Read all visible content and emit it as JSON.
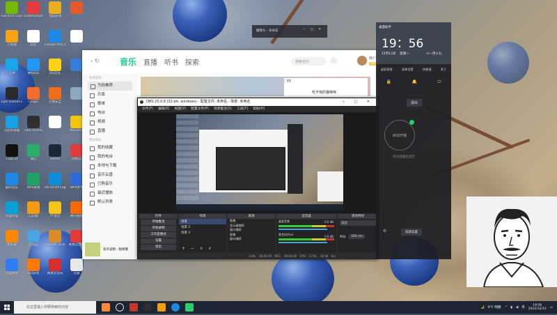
{
  "desktop": {
    "icons": [
      {
        "label": "GeForce Experience",
        "color": "#76b900"
      },
      {
        "label": "GameViewer",
        "color": "#e83c3c"
      },
      {
        "label": "猎狐游戏",
        "color": "#e8b020"
      },
      {
        "label": "",
        "color": "#e55a2a"
      },
      {
        "label": "小狐狸",
        "color": "#f7a21b"
      },
      {
        "label": "必剪",
        "color": "#fff"
      },
      {
        "label": "Google Play 商店",
        "color": "#1e88e5"
      },
      {
        "label": "",
        "color": "#ffffff"
      },
      {
        "label": "飞书",
        "color": "#1aa6e6"
      },
      {
        "label": "腾讯QQ",
        "color": "#2196f3"
      },
      {
        "label": "QQ音乐",
        "color": "#ffd21a"
      },
      {
        "label": "",
        "color": "#3a7dd6"
      },
      {
        "label": "Epic Games Launcher",
        "color": "#2a2a2a"
      },
      {
        "label": "Origin",
        "color": "#f56c2d"
      },
      {
        "label": "火绒安全",
        "color": "#ef6c1c"
      },
      {
        "label": "",
        "color": "#8ab"
      },
      {
        "label": "迅游加速器",
        "color": "#1aa0e6"
      },
      {
        "label": "OBS Studio",
        "color": "#302e31"
      },
      {
        "label": "",
        "color": "#fff"
      },
      {
        "label": "WeGame",
        "color": "#f1c40f"
      },
      {
        "label": "CapCut",
        "color": "#111"
      },
      {
        "label": "微信",
        "color": "#2aae67"
      },
      {
        "label": "Steam",
        "color": "#1b2838"
      },
      {
        "label": "网易云",
        "color": "#e03a3a"
      },
      {
        "label": "酷狗音乐",
        "color": "#1e88e5"
      },
      {
        "label": "WPS表格",
        "color": "#21a366"
      },
      {
        "label": "Microsoft Edge",
        "color": "#0f8ed8"
      },
      {
        "label": "WPS文字",
        "color": "#2f6ad6"
      },
      {
        "label": "哔哩哔哩",
        "color": "#00a1d6"
      },
      {
        "label": "向日葵",
        "color": "#f39c12"
      },
      {
        "label": "YY语音",
        "color": "#f5c518"
      },
      {
        "label": "腾讯视频",
        "color": "#ff6a00"
      },
      {
        "label": "新剪辑",
        "color": "#ff8800"
      },
      {
        "label": "此电脑",
        "color": "#4aa3df"
      },
      {
        "label": "Counter-Strike",
        "color": "#d98c2b"
      },
      {
        "label": "网易云音乐",
        "color": "#e13b3b"
      },
      {
        "label": "百度网盘",
        "color": "#2f7cf6"
      },
      {
        "label": "QQ游戏",
        "color": "#ff7a00"
      },
      {
        "label": "网易云音乐",
        "color": "#d32f2f"
      },
      {
        "label": "迅雷",
        "color": "#e8e8e8"
      }
    ]
  },
  "music_app": {
    "nav": [
      "音乐",
      "直播",
      "听书",
      "探索"
    ],
    "active_nav": "音乐",
    "search_placeholder": "搜索音乐",
    "user": "用户",
    "vip": "VIP",
    "sidebar": {
      "groups": [
        {
          "title": "在线音乐",
          "items": [
            "为你推荐",
            "乐库",
            "歌单",
            "电台",
            "视频",
            "直播"
          ]
        },
        {
          "title": "我的音乐",
          "items": [
            "我的收藏",
            "我的电台",
            "本地与下载",
            "音乐云盘",
            "已购音乐",
            "最近播放",
            "默认列表"
          ]
        }
      ]
    },
    "player": {
      "song": "有声读物 - 眼保健"
    }
  },
  "obs": {
    "title": "OBS 25.0.8 (32-bit, windows) - 配置文件: 未命名 - 场景: 未命名",
    "menu": [
      "文件(F)",
      "编辑(E)",
      "视图(V)",
      "配置文件(P)",
      "场景集合(S)",
      "工具(T)",
      "帮助(H)"
    ],
    "docks": {
      "scenes": "场景",
      "sources": "来源",
      "mixer": "混音器",
      "transitions": "转场特效",
      "controls": "控件"
    },
    "controls": [
      "开始推流",
      "开始录制",
      "工作室模式",
      "设置",
      "退出"
    ],
    "scene_list": [
      "场景",
      "场景 2",
      "场景 3"
    ],
    "source_list": [
      "图像",
      "显示器捕获",
      "窗口捕获",
      "图像",
      "窗口捕获"
    ],
    "mixer": {
      "tracks": [
        {
          "name": "桌面音频",
          "db": "0.0 dB"
        },
        {
          "name": "麦克风/Aux",
          "db": "0.0 dB"
        }
      ]
    },
    "transition": {
      "type": "淡出",
      "duration_label": "时长",
      "duration": "300 ms"
    },
    "status": [
      "LIVE: 00:00:00",
      "REC: 00:00:00",
      "CPU: 0.7%, 30.00 fps"
    ]
  },
  "yy": {
    "title": "YY",
    "text": "吃不饱的猫咪咪"
  },
  "webcam": {
    "title": "摄像头 - 未命名"
  },
  "sidepanel": {
    "title": "桌面助手",
    "time": "19：56",
    "date": "12月12日",
    "weekday": "星期一",
    "lunar": "十一月十九",
    "btn1": "退出",
    "btn2": "启动开播",
    "btn3": "开始直播",
    "btn4": "美颜设置",
    "hint": "开启直播后显示",
    "tabs": [
      "桌面管理",
      "录像设置",
      "快捷键",
      "关于"
    ]
  },
  "taskbar": {
    "search_placeholder": "在这里输入你要搜索的内容",
    "weather": "8°C 晴朗",
    "time": "19:56",
    "date": "2022/12/12",
    "lang": "英"
  }
}
